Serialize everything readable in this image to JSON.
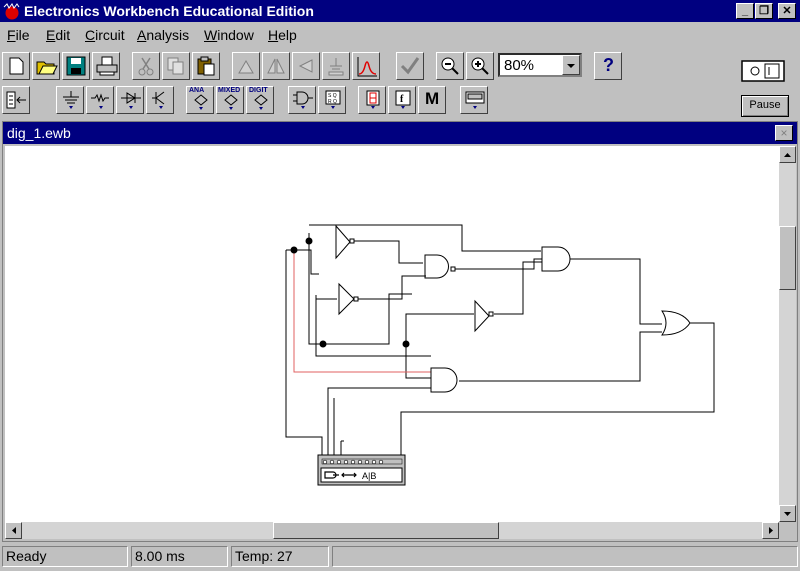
{
  "window": {
    "title": "Electronics Workbench Educational Edition",
    "app_icon": "ewb-app-icon"
  },
  "menu": [
    "File",
    "Edit",
    "Circuit",
    "Analysis",
    "Window",
    "Help"
  ],
  "toolbar": {
    "zoom_value": "80%",
    "help_label": "?",
    "pause_label": "Pause",
    "parts_bins": {
      "analog_ics": "ANA",
      "mixed_ics": "MIXED",
      "digital_ics": "DIGIT",
      "misc": "M"
    }
  },
  "document": {
    "title": "dig_1.ewb",
    "close_label": "×"
  },
  "circuit": {
    "instrument_label": "A|B"
  },
  "status": {
    "state": "Ready",
    "time": "8.00 ms",
    "temp": "Temp: 27"
  }
}
